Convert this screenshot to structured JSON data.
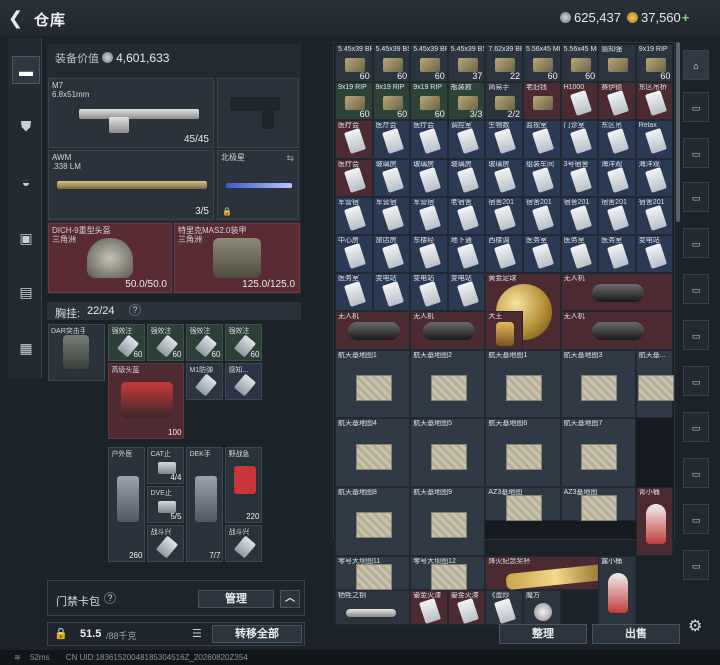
{
  "header": {
    "back_icon": "back-arrow-icon",
    "title": "仓库",
    "silver_amount": "625,437",
    "gold_amount": "37,560",
    "add_symbol": "+"
  },
  "nav": {
    "items": [
      {
        "icon": "gun-icon"
      },
      {
        "icon": "armor-icon"
      },
      {
        "icon": "helmet-icon"
      },
      {
        "icon": "backpack-icon"
      },
      {
        "icon": "vest-icon"
      },
      {
        "icon": "case-icon"
      }
    ]
  },
  "equipment": {
    "value_label": "装备价值",
    "value": "4,601,633",
    "primary": {
      "name": "M7",
      "caliber": "6.8x51mm",
      "ammo": "45/45"
    },
    "secondary": {
      "name": "AWM",
      "caliber": ".338 LM",
      "ammo": "3/5"
    },
    "melee": {
      "name": "北极星"
    },
    "helmet": {
      "name": "DICH-9重型头盔",
      "sub": "三角洲",
      "durability": "50.0/50.0"
    },
    "armor": {
      "name": "特里克MAS2.0装甲",
      "sub": "三角洲",
      "durability": "125.0/125.0"
    }
  },
  "chest": {
    "label": "胸挂:",
    "capacity": "22/24",
    "help": "?"
  },
  "chest_items": [
    {
      "name": "DAR突击手",
      "count": ""
    },
    {
      "name": "强效注",
      "count": "60"
    },
    {
      "name": "强效注",
      "count": "60"
    },
    {
      "name": "强效注",
      "count": "60"
    },
    {
      "name": "强效注",
      "count": "60"
    },
    {
      "name": "高级头盔",
      "count": "100"
    },
    {
      "name": "M1防弹",
      "count": ""
    },
    {
      "name": "感知...",
      "count": ""
    },
    {
      "name": "户外医",
      "count": "260"
    },
    {
      "name": "CAT止",
      "count": "4/4"
    },
    {
      "name": "DVE止",
      "count": "5/5"
    },
    {
      "name": "DEK手",
      "count": "7/7"
    },
    {
      "name": "野战急",
      "count": "220"
    },
    {
      "name": "战斗兴",
      "count": ""
    },
    {
      "name": "战斗兴",
      "count": ""
    }
  ],
  "warehouse_items": [
    {
      "name": "5.45x39 BP",
      "count": "60"
    },
    {
      "name": "5.45x39 BS",
      "count": "60"
    },
    {
      "name": "5.45x39 BP",
      "count": "60"
    },
    {
      "name": "5.45x39 BS",
      "count": "37"
    },
    {
      "name": "7.62x39 BP",
      "count": "22"
    },
    {
      "name": "5.56x45 M855A1",
      "count": "60"
    },
    {
      "name": "5.56x45 M855A1",
      "count": "60"
    },
    {
      "name": "感知强",
      "count": ""
    },
    {
      "name": "9x19 RIP",
      "count": "60"
    },
    {
      "name": "9x19 RIP",
      "count": "60"
    },
    {
      "name": "9x19 RIP",
      "count": "60"
    },
    {
      "name": "9x19 RIP",
      "count": "60"
    },
    {
      "name": "瓶装救",
      "count": "3/3"
    },
    {
      "name": "简易手",
      "count": "2/2"
    },
    {
      "name": "老旧钱",
      "count": ""
    },
    {
      "name": "H1000",
      "count": ""
    },
    {
      "name": "赛伊德",
      "count": ""
    },
    {
      "name": "东区吊桥",
      "count": ""
    },
    {
      "name": "医疗会",
      "count": ""
    },
    {
      "name": "医疗会",
      "count": ""
    },
    {
      "name": "医疗会",
      "count": ""
    },
    {
      "name": "调控室",
      "count": ""
    },
    {
      "name": "生物数",
      "count": ""
    },
    {
      "name": "监视室",
      "count": ""
    },
    {
      "name": "门诊室",
      "count": ""
    },
    {
      "name": "东区吊",
      "count": ""
    },
    {
      "name": "Relax",
      "count": ""
    },
    {
      "name": "医疗会",
      "count": ""
    },
    {
      "name": "玻璃房",
      "count": ""
    },
    {
      "name": "玻璃房",
      "count": ""
    },
    {
      "name": "玻璃房",
      "count": ""
    },
    {
      "name": "玻璃房",
      "count": ""
    },
    {
      "name": "组装车间",
      "count": ""
    },
    {
      "name": "3号宿舍",
      "count": ""
    },
    {
      "name": "海洋观",
      "count": ""
    },
    {
      "name": "海洋观",
      "count": ""
    },
    {
      "name": "军营宿",
      "count": ""
    },
    {
      "name": "军营宿",
      "count": ""
    },
    {
      "name": "军营宿",
      "count": ""
    },
    {
      "name": "老宿舍",
      "count": ""
    },
    {
      "name": "宿舍201",
      "count": ""
    },
    {
      "name": "宿舍201",
      "count": ""
    },
    {
      "name": "宿舍201",
      "count": ""
    },
    {
      "name": "宿舍201",
      "count": ""
    },
    {
      "name": "宿舍201",
      "count": ""
    },
    {
      "name": "中心房",
      "count": ""
    },
    {
      "name": "旅店房",
      "count": ""
    },
    {
      "name": "东楼经",
      "count": ""
    },
    {
      "name": "地下通",
      "count": ""
    },
    {
      "name": "西楼调",
      "count": ""
    },
    {
      "name": "医务室",
      "count": ""
    },
    {
      "name": "医务室",
      "count": ""
    },
    {
      "name": "医务室",
      "count": ""
    },
    {
      "name": "变电站",
      "count": ""
    },
    {
      "name": "医务室",
      "count": ""
    },
    {
      "name": "变电站",
      "count": ""
    },
    {
      "name": "变电站",
      "count": ""
    },
    {
      "name": "变电站",
      "count": ""
    },
    {
      "name": "黄金足球",
      "count": ""
    },
    {
      "name": "无人机",
      "count": ""
    },
    {
      "name": "无人机",
      "count": ""
    },
    {
      "name": "无人机",
      "count": ""
    },
    {
      "name": "大王",
      "count": ""
    },
    {
      "name": "无人机",
      "count": ""
    },
    {
      "name": "航天基地图1",
      "count": ""
    },
    {
      "name": "航天基地图2",
      "count": ""
    },
    {
      "name": "航天基地图1",
      "count": ""
    },
    {
      "name": "航天基地图3",
      "count": ""
    },
    {
      "name": "航天基...",
      "count": ""
    },
    {
      "name": "航天基地图4",
      "count": ""
    },
    {
      "name": "航天基地图5",
      "count": ""
    },
    {
      "name": "航天基地图6",
      "count": ""
    },
    {
      "name": "航天基地图7",
      "count": ""
    },
    {
      "name": "航天基地图8",
      "count": ""
    },
    {
      "name": "航天基地图9",
      "count": ""
    },
    {
      "name": "AZ3基地图",
      "count": ""
    },
    {
      "name": "AZ3基地图",
      "count": ""
    },
    {
      "name": "青小桶",
      "count": ""
    },
    {
      "name": "零号大坝图11",
      "count": ""
    },
    {
      "name": "零号大坝图12",
      "count": ""
    },
    {
      "name": "烽火纪念奖杯",
      "count": ""
    },
    {
      "name": "露小桶",
      "count": ""
    },
    {
      "name": "牺牲之钥",
      "count": ""
    },
    {
      "name": "鎏金火漆",
      "count": ""
    },
    {
      "name": "鎏金火漆",
      "count": ""
    },
    {
      "name": "《蛋炒",
      "count": ""
    },
    {
      "name": "魔方",
      "count": ""
    }
  ],
  "bottom": {
    "keycard_label": "门禁卡包",
    "keycard_help": "?",
    "manage_label": "管理",
    "weight": "51.5",
    "weight_max": "/88千克",
    "transfer_all": "转移全部",
    "organize": "整理",
    "sell": "出售"
  },
  "status": {
    "ping": "52ms",
    "uid": "CN UID:18361520048185304516Z_20260820Z354"
  },
  "colors": {
    "gold": "#e8b84a",
    "red_slot": "#5a2b33",
    "accent": "#ffffff"
  }
}
